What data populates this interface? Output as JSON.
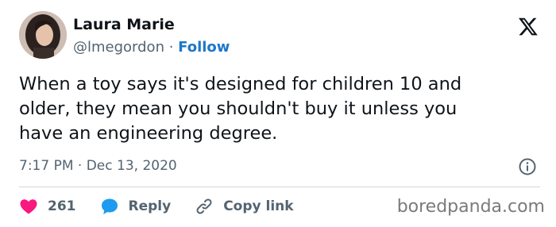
{
  "user": {
    "name": "Laura Marie",
    "handle": "@lmegordon",
    "separator": " · ",
    "follow_label": "Follow"
  },
  "tweet": {
    "text": "When a toy says it's designed for children 10 and\nolder, they mean you shouldn't buy it unless you\nhave an engineering degree.",
    "timestamp": "7:17 PM · Dec 13, 2020"
  },
  "actions": {
    "like_count": "261",
    "reply_label": "Reply",
    "copy_link_label": "Copy link"
  },
  "watermark": "boredpanda.com",
  "icons": {
    "logo": "x-logo-icon",
    "info": "info-icon",
    "like": "heart-icon",
    "reply": "reply-bubble-icon",
    "copy": "link-icon"
  },
  "colors": {
    "like": "#f91880",
    "reply": "#1d9bf0",
    "follow": "#1d77c8",
    "secondary_text": "#536471"
  }
}
